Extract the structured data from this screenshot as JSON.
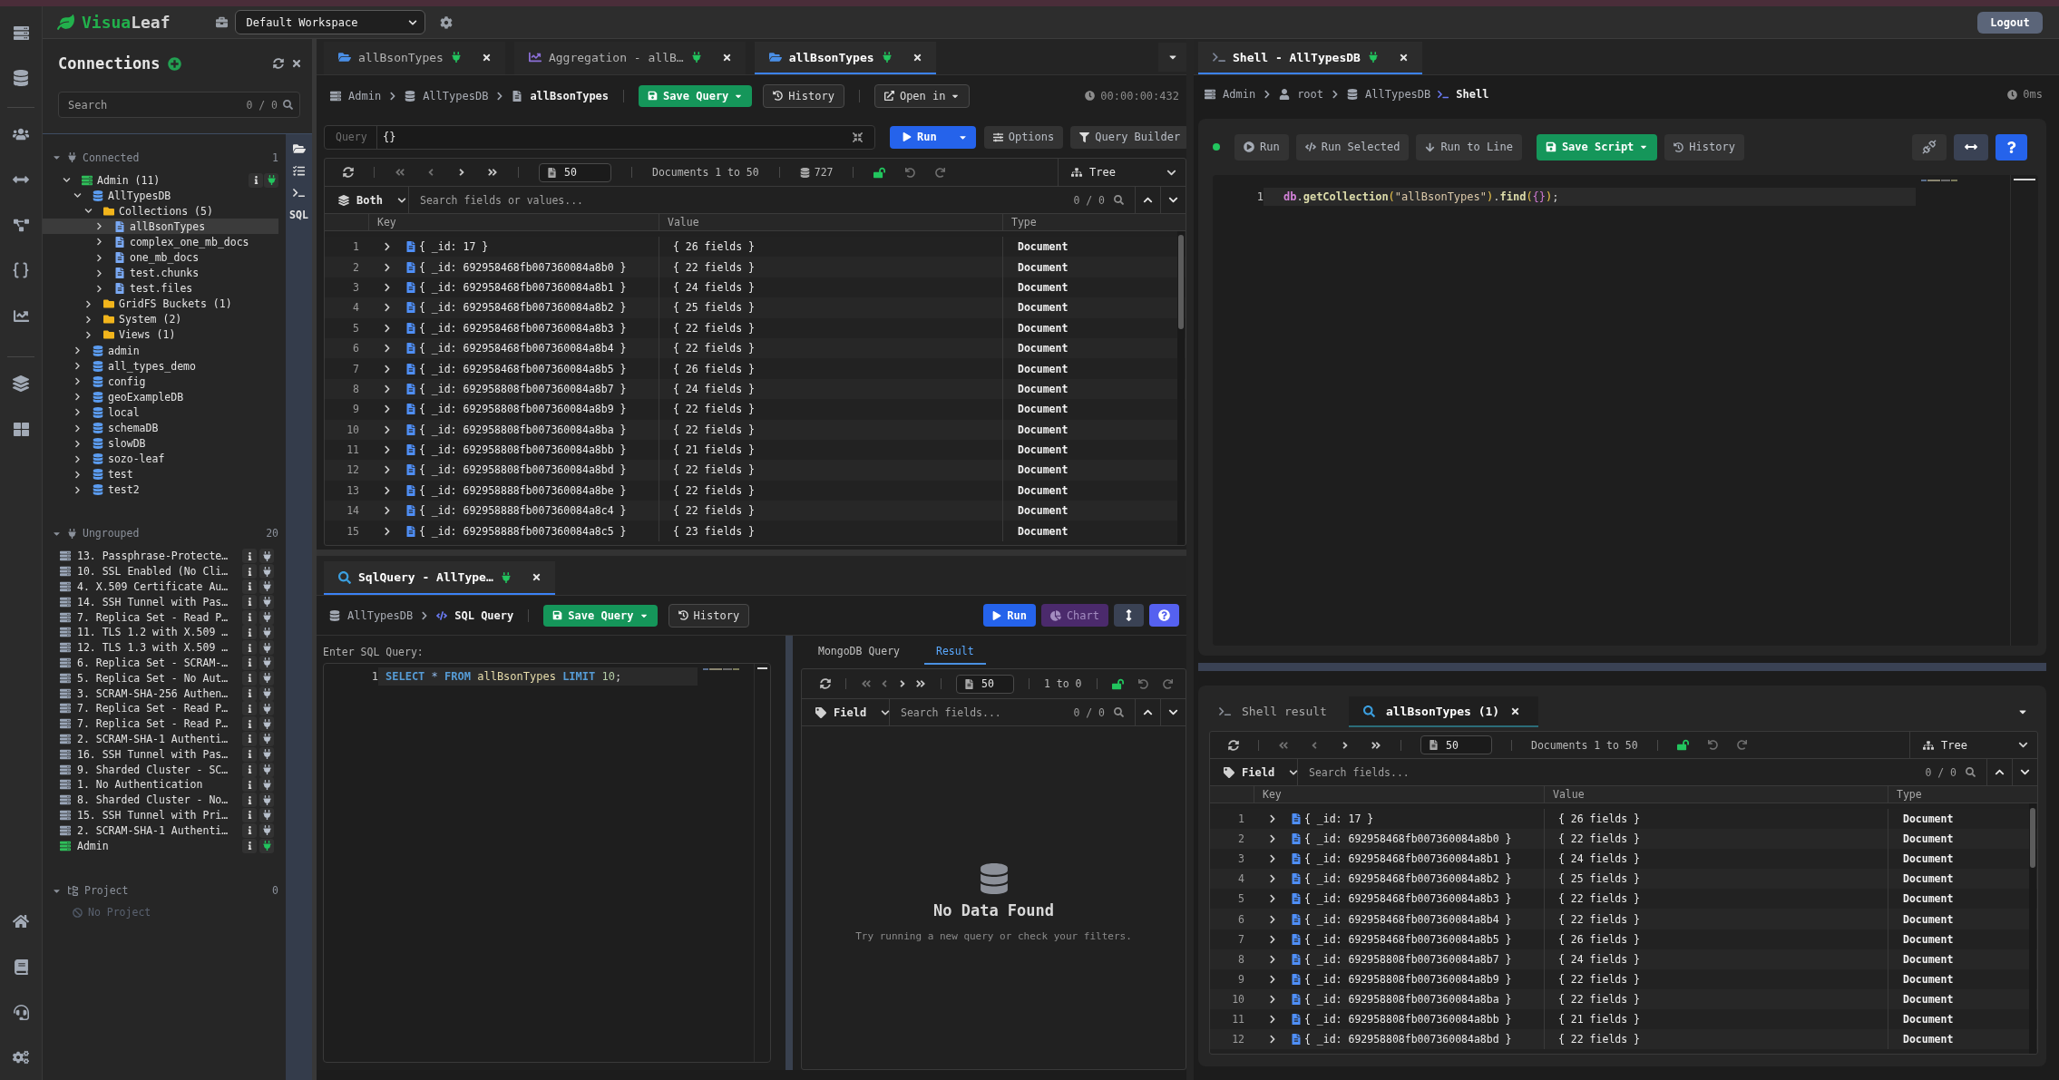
{
  "topbar": {
    "logo": {
      "first": "Visua",
      "second": "Leaf"
    },
    "workspace": "Default Workspace",
    "logout": "Logout"
  },
  "connections": {
    "title": "Connections",
    "search": {
      "placeholder": "Search",
      "count": "0 / 0"
    },
    "connected": {
      "label": "Connected",
      "count": "1",
      "expanded": true,
      "nodes": [
        {
          "kind": "connection",
          "label": "Admin (11)",
          "connected": true,
          "expanded": true,
          "selected": false,
          "children": [
            {
              "kind": "database",
              "label": "AllTypesDB",
              "expanded": true,
              "selected": false,
              "children": [
                {
                  "kind": "folder",
                  "label": "Collections (5)",
                  "expanded": true,
                  "selected": false,
                  "children": [
                    {
                      "kind": "collection",
                      "label": "allBsonTypes",
                      "expanded": false,
                      "selected": true
                    },
                    {
                      "kind": "collection",
                      "label": "complex_one_mb_docs",
                      "expanded": false,
                      "selected": false
                    },
                    {
                      "kind": "collection",
                      "label": "one_mb_docs",
                      "expanded": false,
                      "selected": false
                    },
                    {
                      "kind": "collection",
                      "label": "test.chunks",
                      "expanded": false,
                      "selected": false
                    },
                    {
                      "kind": "collection",
                      "label": "test.files",
                      "expanded": false,
                      "selected": false
                    }
                  ]
                },
                {
                  "kind": "folder",
                  "label": "GridFS Buckets (1)",
                  "expanded": false,
                  "selected": false
                },
                {
                  "kind": "folder",
                  "label": "System (2)",
                  "expanded": false,
                  "selected": false
                },
                {
                  "kind": "folder",
                  "label": "Views (1)",
                  "expanded": false,
                  "selected": false
                }
              ]
            },
            {
              "kind": "database",
              "label": "admin",
              "expanded": false,
              "selected": false
            },
            {
              "kind": "database",
              "label": "all_types_demo",
              "expanded": false,
              "selected": false
            },
            {
              "kind": "database",
              "label": "config",
              "expanded": false,
              "selected": false
            },
            {
              "kind": "database",
              "label": "geoExampleDB",
              "expanded": false,
              "selected": false
            },
            {
              "kind": "database",
              "label": "local",
              "expanded": false,
              "selected": false
            },
            {
              "kind": "database",
              "label": "schemaDB",
              "expanded": false,
              "selected": false
            },
            {
              "kind": "database",
              "label": "slowDB",
              "expanded": false,
              "selected": false
            },
            {
              "kind": "database",
              "label": "sozo-leaf",
              "expanded": false,
              "selected": false
            },
            {
              "kind": "database",
              "label": "test",
              "expanded": false,
              "selected": false
            },
            {
              "kind": "database",
              "label": "test2",
              "expanded": false,
              "selected": false
            }
          ]
        }
      ]
    },
    "ungrouped": {
      "label": "Ungrouped",
      "count": "20",
      "expanded": true,
      "items": [
        {
          "label": "13. Passphrase-Protecte…",
          "connected": false,
          "selected": false
        },
        {
          "label": "10. SSL Enabled (No Cli…",
          "connected": false,
          "selected": false
        },
        {
          "label": "4. X.509 Certificate Au…",
          "connected": false,
          "selected": false
        },
        {
          "label": "14. SSH Tunnel with Pas…",
          "connected": false,
          "selected": false
        },
        {
          "label": "7. Replica Set - Read P…",
          "connected": false,
          "selected": false
        },
        {
          "label": "11. TLS 1.2 with X.509 …",
          "connected": false,
          "selected": false
        },
        {
          "label": "12. TLS 1.3 with X.509 …",
          "connected": false,
          "selected": false
        },
        {
          "label": "6. Replica Set - SCRAM-…",
          "connected": false,
          "selected": false
        },
        {
          "label": "5. Replica Set - No Aut…",
          "connected": false,
          "selected": false
        },
        {
          "label": "3. SCRAM-SHA-256 Authen…",
          "connected": false,
          "selected": false
        },
        {
          "label": "7. Replica Set - Read P…",
          "connected": false,
          "selected": false
        },
        {
          "label": "7. Replica Set - Read P…",
          "connected": false,
          "selected": false
        },
        {
          "label": "2. SCRAM-SHA-1 Authenti…",
          "connected": false,
          "selected": false
        },
        {
          "label": "16. SSH Tunnel with Pas…",
          "connected": false,
          "selected": false
        },
        {
          "label": "9. Sharded Cluster - SC…",
          "connected": false,
          "selected": false
        },
        {
          "label": "1. No Authentication",
          "connected": false,
          "selected": false
        },
        {
          "label": "8. Sharded Cluster - No…",
          "connected": false,
          "selected": false
        },
        {
          "label": "15. SSH Tunnel with Pri…",
          "connected": false,
          "selected": false
        },
        {
          "label": "2. SCRAM-SHA-1 Authenti…",
          "connected": false,
          "selected": false
        },
        {
          "label": "Admin",
          "connected": true,
          "selected": false
        }
      ]
    },
    "project": {
      "label": "Project",
      "count": "0",
      "expanded": true,
      "empty": "No Project"
    }
  },
  "tools": {
    "sql": "SQL"
  },
  "collection_view": {
    "tabs": [
      {
        "kind": "collection",
        "label": "allBsonTypes",
        "selected": false,
        "connected": true
      },
      {
        "kind": "aggregation",
        "label": "Aggregation - allB…",
        "selected": false,
        "connected": true
      },
      {
        "kind": "collection",
        "label": "allBsonTypes",
        "selected": true,
        "connected": true
      }
    ],
    "breadcrumb": [
      {
        "kind": "connection",
        "label": "Admin"
      },
      {
        "kind": "database",
        "label": "AllTypesDB"
      },
      {
        "kind": "collection",
        "label": "allBsonTypes"
      }
    ],
    "actions": {
      "save": "Save Query",
      "history": "History",
      "open_in": "Open in"
    },
    "elapsed": "00:00:00:432",
    "query": {
      "label": "Query",
      "value": "{}"
    },
    "query_actions": {
      "run": "Run",
      "options": "Options",
      "builder": "Query Builder"
    },
    "grid": {
      "pager": {
        "page_size": "50",
        "range": "Documents 1 to 50",
        "total": "727",
        "locked": false,
        "view": "Tree"
      },
      "search": {
        "filter": "Both",
        "placeholder": "Search fields or values...",
        "count": "0 / 0"
      },
      "columns": [
        "Key",
        "Value",
        "Type"
      ],
      "rows": [
        {
          "number": "1",
          "key": "{ _id: 17 }",
          "value": "{ 26 fields }",
          "type": "Document"
        },
        {
          "number": "2",
          "key": "{ _id: 692958468fb007360084a8b0 }",
          "value": "{ 22 fields }",
          "type": "Document"
        },
        {
          "number": "3",
          "key": "{ _id: 692958468fb007360084a8b1 }",
          "value": "{ 24 fields }",
          "type": "Document"
        },
        {
          "number": "4",
          "key": "{ _id: 692958468fb007360084a8b2 }",
          "value": "{ 25 fields }",
          "type": "Document"
        },
        {
          "number": "5",
          "key": "{ _id: 692958468fb007360084a8b3 }",
          "value": "{ 22 fields }",
          "type": "Document"
        },
        {
          "number": "6",
          "key": "{ _id: 692958468fb007360084a8b4 }",
          "value": "{ 22 fields }",
          "type": "Document"
        },
        {
          "number": "7",
          "key": "{ _id: 692958468fb007360084a8b5 }",
          "value": "{ 26 fields }",
          "type": "Document"
        },
        {
          "number": "8",
          "key": "{ _id: 692958808fb007360084a8b7 }",
          "value": "{ 24 fields }",
          "type": "Document"
        },
        {
          "number": "9",
          "key": "{ _id: 692958808fb007360084a8b9 }",
          "value": "{ 22 fields }",
          "type": "Document"
        },
        {
          "number": "10",
          "key": "{ _id: 692958808fb007360084a8ba }",
          "value": "{ 22 fields }",
          "type": "Document"
        },
        {
          "number": "11",
          "key": "{ _id: 692958808fb007360084a8bb }",
          "value": "{ 21 fields }",
          "type": "Document"
        },
        {
          "number": "12",
          "key": "{ _id: 692958808fb007360084a8bd }",
          "value": "{ 22 fields }",
          "type": "Document"
        },
        {
          "number": "13",
          "key": "{ _id: 692958888fb007360084a8be }",
          "value": "{ 22 fields }",
          "type": "Document"
        },
        {
          "number": "14",
          "key": "{ _id: 692958888fb007360084a8c4 }",
          "value": "{ 22 fields }",
          "type": "Document"
        },
        {
          "number": "15",
          "key": "{ _id: 692958888fb007360084a8c5 }",
          "value": "{ 23 fields }",
          "type": "Document"
        }
      ]
    }
  },
  "sql_view": {
    "tab": {
      "kind": "query",
      "label": "SqlQuery - AllType…",
      "selected": true,
      "connected": true
    },
    "breadcrumb": [
      {
        "kind": "database",
        "label": "AllTypesDB"
      },
      {
        "kind": "sql",
        "label": "SQL Query"
      }
    ],
    "actions": {
      "save": "Save Query",
      "history": "History",
      "run": "Run",
      "chart": {
        "label": "Chart",
        "disabled": true
      }
    },
    "editor": {
      "label": "Enter SQL Query:",
      "lines": [
        {
          "number": "1",
          "current": true,
          "words": [
            [
              {
                "kind": "keyword",
                "text": "SELECT"
              }
            ],
            [
              {
                "kind": "operator",
                "text": "*"
              }
            ],
            [
              {
                "kind": "keyword",
                "text": "FROM"
              }
            ],
            [
              {
                "kind": "identifier",
                "text": "allBsonTypes"
              }
            ],
            [
              {
                "kind": "keyword",
                "text": "LIMIT"
              }
            ],
            [
              {
                "kind": "number",
                "text": "10"
              },
              {
                "kind": "punct",
                "text": ";"
              }
            ]
          ]
        }
      ]
    },
    "result_tabs": [
      {
        "label": "MongoDB Query",
        "selected": false
      },
      {
        "label": "Result",
        "selected": true
      }
    ],
    "grid": {
      "pager": {
        "page_size": "50",
        "range": "1 to 0",
        "locked": false
      },
      "search": {
        "filter": "Field",
        "placeholder": "Search fields...",
        "count": "0 / 0"
      },
      "empty": {
        "title": "No Data Found",
        "message": "Try running a new query or check your filters."
      }
    }
  },
  "shell_view": {
    "tab": {
      "kind": "shell",
      "label": "Shell - AllTypesDB",
      "selected": true,
      "connected": true
    },
    "breadcrumb": [
      {
        "kind": "connection",
        "label": "Admin"
      },
      {
        "kind": "user",
        "label": "root"
      },
      {
        "kind": "database",
        "label": "AllTypesDB"
      },
      {
        "kind": "shell",
        "label": "Shell"
      }
    ],
    "elapsed": "0ms",
    "status": {
      "connected": true
    },
    "actions": {
      "run": "Run",
      "run_selected": "Run Selected",
      "run_to_line": "Run to Line",
      "save": "Save Script",
      "history": "History"
    },
    "editor": {
      "lines": [
        {
          "number": "1",
          "current": true,
          "words": [
            [
              {
                "kind": "variable",
                "text": "db"
              },
              {
                "kind": "punct",
                "text": "."
              },
              {
                "kind": "function",
                "text": "getCollection"
              },
              {
                "kind": "bracket",
                "text": "("
              },
              {
                "kind": "string",
                "text": "\"allBsonTypes\""
              },
              {
                "kind": "bracket",
                "text": ")"
              },
              {
                "kind": "punct",
                "text": "."
              },
              {
                "kind": "function",
                "text": "find"
              },
              {
                "kind": "bracket",
                "text": "("
              },
              {
                "kind": "brace",
                "text": "{}"
              },
              {
                "kind": "bracket",
                "text": ")"
              },
              {
                "kind": "punct",
                "text": ";"
              }
            ]
          ]
        }
      ]
    },
    "results": {
      "tabs": [
        {
          "kind": "shell",
          "label": "Shell result",
          "selected": false,
          "closable": false
        },
        {
          "kind": "query",
          "label": "allBsonTypes (1)",
          "selected": true,
          "closable": true
        }
      ],
      "grid": {
        "pager": {
          "page_size": "50",
          "range": "Documents 1 to 50",
          "locked": false,
          "view": "Tree"
        },
        "search": {
          "filter": "Field",
          "placeholder": "Search fields...",
          "count": "0 / 0"
        },
        "columns": [
          "Key",
          "Value",
          "Type"
        ],
        "rows": [
          {
            "number": "1",
            "key": "{ _id: 17 }",
            "value": "{ 26 fields }",
            "type": "Document"
          },
          {
            "number": "2",
            "key": "{ _id: 692958468fb007360084a8b0 }",
            "value": "{ 22 fields }",
            "type": "Document"
          },
          {
            "number": "3",
            "key": "{ _id: 692958468fb007360084a8b1 }",
            "value": "{ 24 fields }",
            "type": "Document"
          },
          {
            "number": "4",
            "key": "{ _id: 692958468fb007360084a8b2 }",
            "value": "{ 25 fields }",
            "type": "Document"
          },
          {
            "number": "5",
            "key": "{ _id: 692958468fb007360084a8b3 }",
            "value": "{ 22 fields }",
            "type": "Document"
          },
          {
            "number": "6",
            "key": "{ _id: 692958468fb007360084a8b4 }",
            "value": "{ 22 fields }",
            "type": "Document"
          },
          {
            "number": "7",
            "key": "{ _id: 692958468fb007360084a8b5 }",
            "value": "{ 26 fields }",
            "type": "Document"
          },
          {
            "number": "8",
            "key": "{ _id: 692958808fb007360084a8b7 }",
            "value": "{ 24 fields }",
            "type": "Document"
          },
          {
            "number": "9",
            "key": "{ _id: 692958808fb007360084a8b9 }",
            "value": "{ 22 fields }",
            "type": "Document"
          },
          {
            "number": "10",
            "key": "{ _id: 692958808fb007360084a8ba }",
            "value": "{ 22 fields }",
            "type": "Document"
          },
          {
            "number": "11",
            "key": "{ _id: 692958808fb007360084a8bb }",
            "value": "{ 21 fields }",
            "type": "Document"
          },
          {
            "number": "12",
            "key": "{ _id: 692958808fb007360084a8bd }",
            "value": "{ 22 fields }",
            "type": "Document"
          }
        ]
      }
    }
  }
}
